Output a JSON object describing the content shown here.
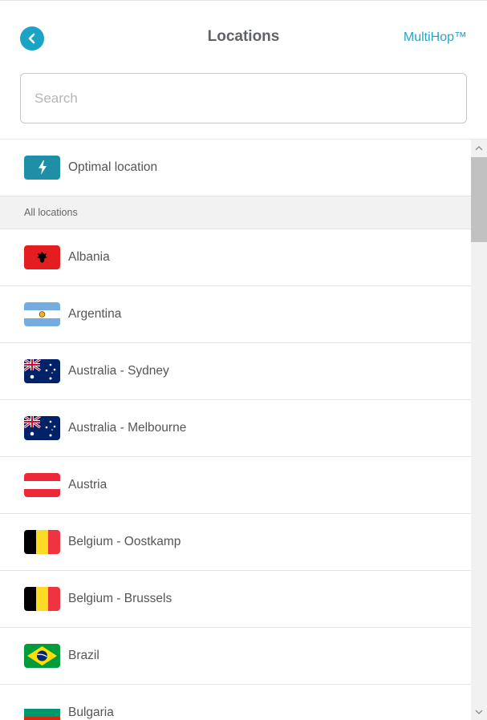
{
  "header": {
    "title": "Locations",
    "multihop_label": "MultiHop™",
    "back_icon": "chevron-left-icon"
  },
  "search": {
    "placeholder": "Search",
    "value": ""
  },
  "optimal": {
    "label": "Optimal location",
    "icon": "lightning-bolt-icon"
  },
  "section": {
    "label": "All locations"
  },
  "locations": [
    {
      "name": "Albania",
      "flag": "albania"
    },
    {
      "name": "Argentina",
      "flag": "argentina"
    },
    {
      "name": "Australia - Sydney",
      "flag": "australia"
    },
    {
      "name": "Australia - Melbourne",
      "flag": "australia"
    },
    {
      "name": "Austria",
      "flag": "austria"
    },
    {
      "name": "Belgium - Oostkamp",
      "flag": "belgium"
    },
    {
      "name": "Belgium - Brussels",
      "flag": "belgium"
    },
    {
      "name": "Brazil",
      "flag": "brazil"
    },
    {
      "name": "Bulgaria",
      "flag": "bulgaria"
    }
  ],
  "colors": {
    "accent": "#1ba3c6",
    "multihop_link": "#2aa4c5",
    "optimal_bg": "#1f8fa8",
    "section_bg": "#f2f2f2"
  }
}
